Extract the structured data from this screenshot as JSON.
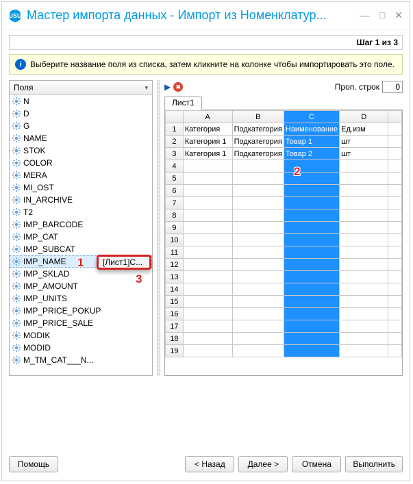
{
  "window": {
    "logo": "USU",
    "title": "Мастер импорта данных - Импорт из Номенклатур...",
    "min": "—",
    "max": "□",
    "close": "✕"
  },
  "step": "Шаг 1 из 3",
  "info": "Выберите название поля из списка, затем кликните на колонке чтобы импортировать это поле.",
  "left": {
    "header": "Поля",
    "fields": [
      "N",
      "D",
      "G",
      "NAME",
      "STOK",
      "COLOR",
      "MERA",
      "MI_OST",
      "IN_ARCHIVE",
      "T2",
      "IMP_BARCODE",
      "IMP_CAT",
      "IMP_SUBCAT",
      "IMP_NAME",
      "IMP_SKLAD",
      "IMP_AMOUNT",
      "IMP_UNITS",
      "IMP_PRICE_POKUP",
      "IMP_PRICE_SALE",
      "MODIK",
      "MODID",
      "M_TM_CAT___N..."
    ],
    "selected_index": 13
  },
  "callout": {
    "text": "[Лист1]С..."
  },
  "badges": {
    "b1": "1",
    "b2": "2",
    "b3": "3"
  },
  "right": {
    "skip_label": "Проп. строк",
    "skip_value": "0",
    "sheet_tab": "Лист1",
    "cols": [
      "A",
      "B",
      "C",
      "D"
    ],
    "highlight_col": 2,
    "rows": [
      [
        "Категория",
        "Подкатегория",
        "Наименование",
        "Ед.изм"
      ],
      [
        "Категория 1",
        "Подкатегория",
        "Товар 1",
        "шт"
      ],
      [
        "Категория 1",
        "Подкатегория",
        "Товар 2",
        "шт"
      ]
    ],
    "total_rows": 19
  },
  "buttons": {
    "help": "Помощь",
    "back": "< Назад",
    "next": "Далее >",
    "cancel": "Отмена",
    "run": "Выполнить"
  }
}
